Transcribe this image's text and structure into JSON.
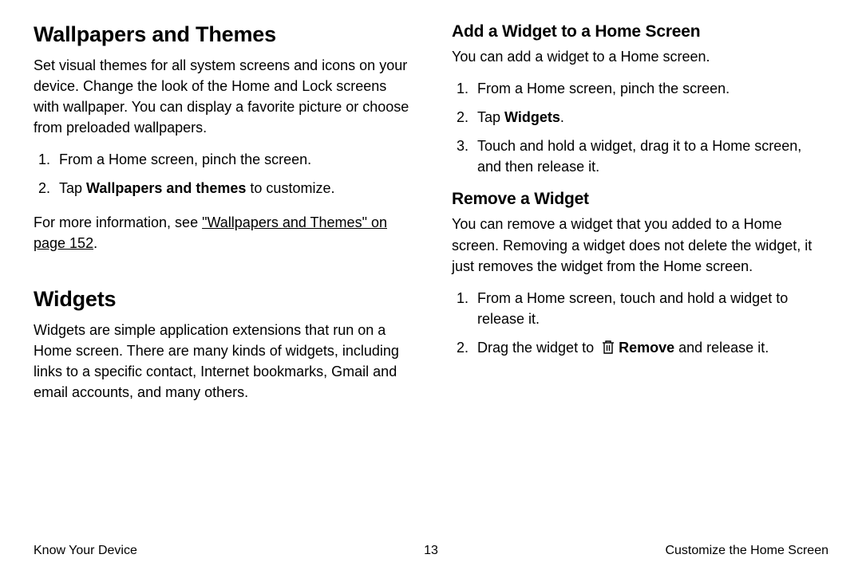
{
  "left": {
    "section1": {
      "title": "Wallpapers and Themes",
      "intro": "Set visual themes for all system screens and icons on your device. Change the look of the Home and Lock screens with wallpaper. You can display a favorite picture or choose from preloaded wallpapers.",
      "steps": [
        {
          "pre": "From a Home screen, pinch the screen."
        },
        {
          "pre": "Tap ",
          "bold": "Wallpapers and themes",
          "post": " to customize."
        }
      ],
      "xref_pre": "For more information, see ",
      "xref_text": "\"Wallpapers and Themes\" on page 152",
      "xref_post": "."
    },
    "section2": {
      "title": "Widgets",
      "intro": "Widgets are simple application extensions that run on a Home screen. There are many kinds of widgets, including links to a specific contact, Internet bookmarks, Gmail and email accounts, and many others."
    }
  },
  "right": {
    "sub1": {
      "title": "Add a Widget to a Home Screen",
      "intro": "You can add a widget to a Home screen.",
      "steps": [
        {
          "pre": "From a Home screen, pinch the screen."
        },
        {
          "pre": "Tap ",
          "bold": "Widgets",
          "post": "."
        },
        {
          "pre": "Touch and hold a widget, drag it to a Home screen, and then release it."
        }
      ]
    },
    "sub2": {
      "title": "Remove a Widget",
      "intro": "You can remove a widget that you added to a Home screen. Removing a widget does not delete the widget, it just removes the widget from the Home screen.",
      "steps": [
        {
          "pre": "From a Home screen, touch and hold a widget to release it."
        },
        {
          "pre": "Drag the widget to ",
          "icon": "trash-icon",
          "bold": "Remove",
          "post": " and release it."
        }
      ]
    }
  },
  "footer": {
    "left": "Know Your Device",
    "center": "13",
    "right": "Customize the Home Screen"
  }
}
